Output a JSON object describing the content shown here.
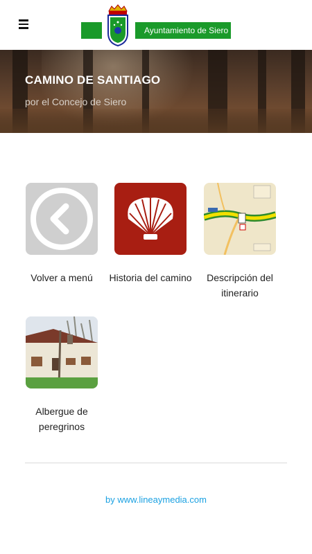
{
  "header": {
    "menu_icon": "hamburger-icon",
    "logo_text": "Ayuntamiento de Siero",
    "brand_color": "#1a9a2a"
  },
  "hero": {
    "title": "CAMINO DE SANTIAGO",
    "subtitle": "por el Concejo de Siero"
  },
  "tiles": [
    {
      "label": "Volver a menú",
      "icon": "back-arrow-icon"
    },
    {
      "label": "Historia del camino",
      "icon": "scallop-shell-icon"
    },
    {
      "label": "Descripción del itinerario",
      "icon": "route-map-thumbnail"
    },
    {
      "label": "Albergue de peregrinos",
      "icon": "hostel-photo-thumbnail"
    }
  ],
  "footer": {
    "link_text": "by www.lineaymedia.com",
    "link_color": "#1ba1e2"
  }
}
